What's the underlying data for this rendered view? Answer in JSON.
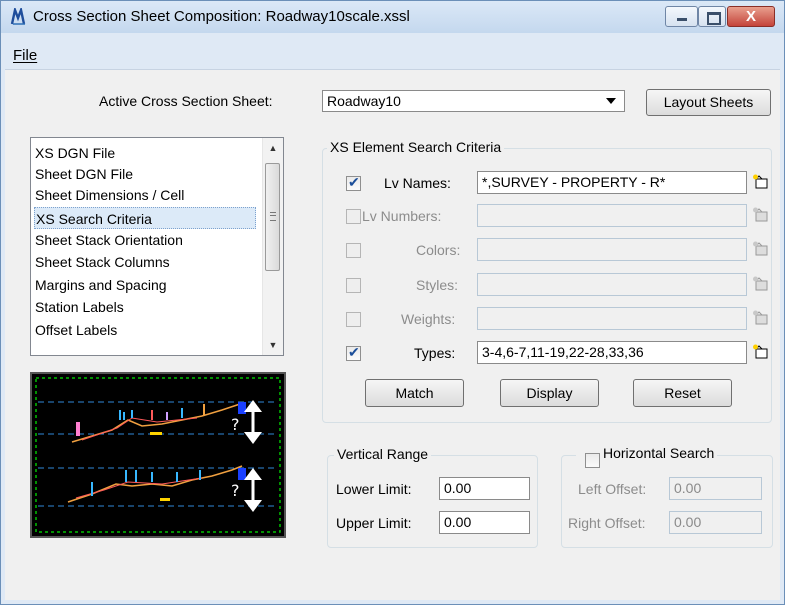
{
  "window": {
    "title": "Cross Section Sheet Composition: Roadway10scale.xssl",
    "controls": {
      "minimize": "minimize",
      "maximize": "maximize",
      "close": "X"
    }
  },
  "menu": {
    "file": "File"
  },
  "active_sheet": {
    "label": "Active Cross Section Sheet:",
    "value": "Roadway10",
    "layout_button": "Layout Sheets"
  },
  "categories": {
    "items": [
      "XS DGN File",
      "Sheet DGN File",
      "Sheet Dimensions / Cell",
      "XS Search Criteria",
      "Sheet Stack Orientation",
      "Sheet Stack Columns",
      "Margins and Spacing",
      "Station Labels",
      "Offset Labels"
    ],
    "selected": "XS Search Criteria"
  },
  "search_criteria": {
    "title": "XS Element Search Criteria",
    "rows": [
      {
        "label": "Lv Names:",
        "value": "*,SURVEY - PROPERTY - R*",
        "checked": true,
        "enabled": true
      },
      {
        "label": "Lv Numbers:",
        "value": "",
        "checked": false,
        "enabled": false
      },
      {
        "label": "Colors:",
        "value": "",
        "checked": false,
        "enabled": false
      },
      {
        "label": "Styles:",
        "value": "",
        "checked": false,
        "enabled": false
      },
      {
        "label": "Weights:",
        "value": "",
        "checked": false,
        "enabled": false
      },
      {
        "label": "Types:",
        "value": "3-4,6-7,11-19,22-28,33,36",
        "checked": true,
        "enabled": true
      }
    ],
    "buttons": {
      "match": "Match",
      "display": "Display",
      "reset": "Reset"
    }
  },
  "vertical_range": {
    "title": "Vertical Range",
    "lower_label": "Lower Limit:",
    "lower_value": "0.00",
    "upper_label": "Upper Limit:",
    "upper_value": "0.00"
  },
  "horizontal_search": {
    "title": "Horizontal Search",
    "checked": false,
    "left_label": "Left Offset:",
    "left_value": "0.00",
    "right_label": "Right Offset:",
    "right_value": "0.00"
  },
  "colors": {
    "titlebar": "#c4d8ee",
    "selection": "#dceaf8",
    "check": "#1c4f9a",
    "preview_bg": "#000000"
  },
  "icons": {
    "app": "cross-section-app-icon",
    "picker": "level-picker-icon",
    "preview": "cross-section-sheet-preview"
  }
}
